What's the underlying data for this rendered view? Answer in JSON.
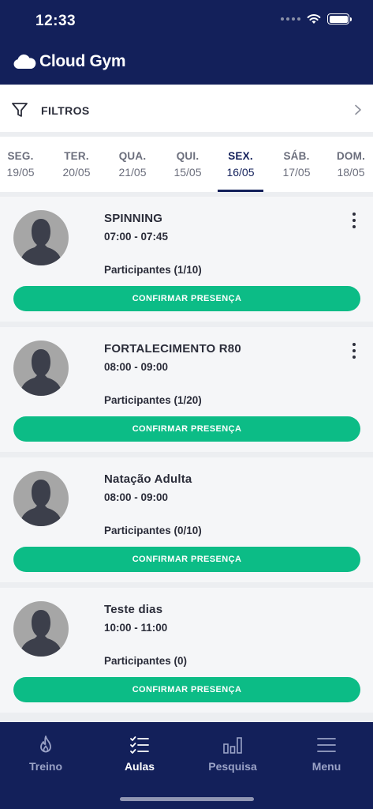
{
  "status_bar": {
    "time": "12:33"
  },
  "header": {
    "app_name": "Cloud Gym"
  },
  "filters": {
    "label": "FILTROS"
  },
  "days": [
    {
      "name": "SEG.",
      "date": "19/05",
      "active": false
    },
    {
      "name": "TER.",
      "date": "20/05",
      "active": false
    },
    {
      "name": "QUA.",
      "date": "21/05",
      "active": false
    },
    {
      "name": "QUI.",
      "date": "15/05",
      "active": false
    },
    {
      "name": "SEX.",
      "date": "16/05",
      "active": true
    },
    {
      "name": "SÁB.",
      "date": "17/05",
      "active": false
    },
    {
      "name": "DOM.",
      "date": "18/05",
      "active": false
    }
  ],
  "classes": [
    {
      "title": "SPINNING",
      "time": "07:00 - 07:45",
      "participants": "Participantes (1/10)",
      "action": "CONFIRMAR PRESENÇA",
      "has_menu": true
    },
    {
      "title": "FORTALECIMENTO R80",
      "time": "08:00 - 09:00",
      "participants": "Participantes (1/20)",
      "action": "CONFIRMAR PRESENÇA",
      "has_menu": true
    },
    {
      "title": "Natação Adulta",
      "time": "08:00 - 09:00",
      "participants": "Participantes (0/10)",
      "action": "CONFIRMAR PRESENÇA",
      "has_menu": false
    },
    {
      "title": "Teste dias",
      "time": "10:00 - 11:00",
      "participants": "Participantes (0)",
      "action": "CONFIRMAR PRESENÇA",
      "has_menu": false
    }
  ],
  "bottom_nav": [
    {
      "label": "Treino",
      "icon": "flame-icon",
      "active": false
    },
    {
      "label": "Aulas",
      "icon": "checklist-icon",
      "active": true
    },
    {
      "label": "Pesquisa",
      "icon": "bar-chart-icon",
      "active": false
    },
    {
      "label": "Menu",
      "icon": "hamburger-menu-icon",
      "active": false
    }
  ],
  "colors": {
    "primary": "#13205a",
    "accent": "#0cbc86",
    "background": "#eceef1",
    "card": "#f5f6f8"
  }
}
